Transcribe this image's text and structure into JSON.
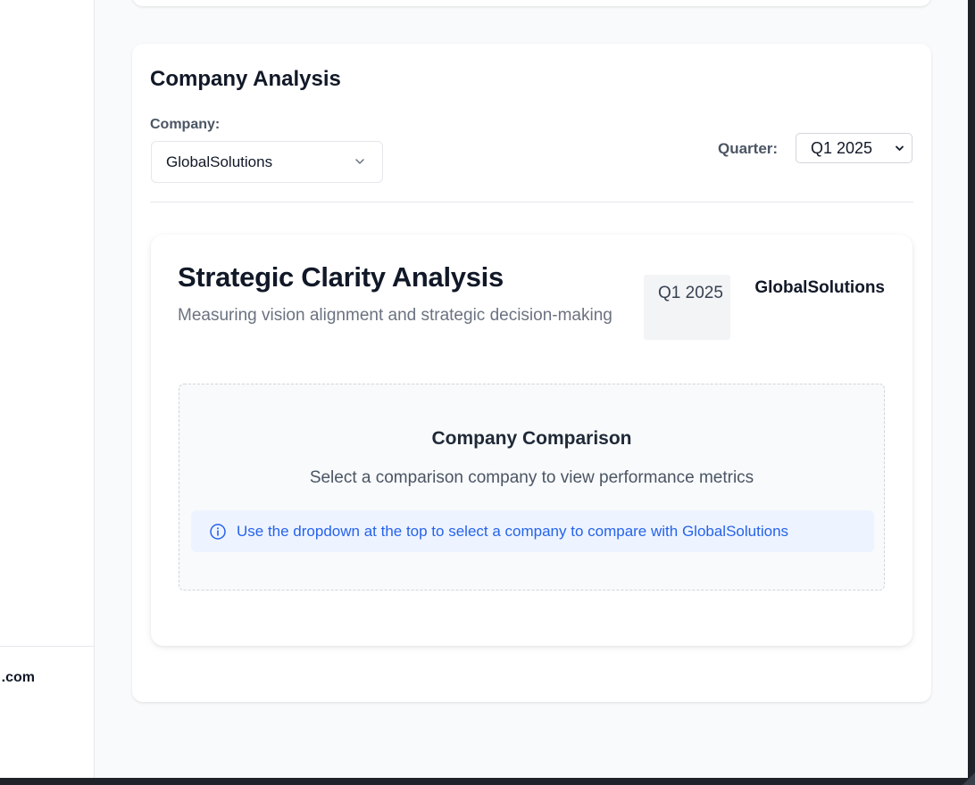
{
  "sidebar": {
    "footer_text": ".com"
  },
  "company_analysis": {
    "title": "Company Analysis",
    "company_label": "Company:",
    "company_value": "GlobalSolutions",
    "quarter_label": "Quarter:",
    "quarter_value": "Q1 2025"
  },
  "strategic_card": {
    "title": "Strategic Clarity Analysis",
    "subtitle": "Measuring vision alignment and strategic decision-making",
    "quarter_badge": "Q1 2025",
    "company_name": "GlobalSolutions"
  },
  "comparison": {
    "title": "Company Comparison",
    "description": "Select a comparison company to view performance metrics",
    "info_text": "Use the dropdown at the top to select a company to compare with GlobalSolutions"
  },
  "icons": {
    "company_dropdown": "chevron-down-icon",
    "quarter_dropdown": "chevron-down-icon",
    "info": "info-circle-icon"
  },
  "colors": {
    "accent_blue": "#2563eb",
    "info_bg": "#eef4ff",
    "page_bg": "#f9fafb",
    "frame_bg": "#1f2229"
  }
}
